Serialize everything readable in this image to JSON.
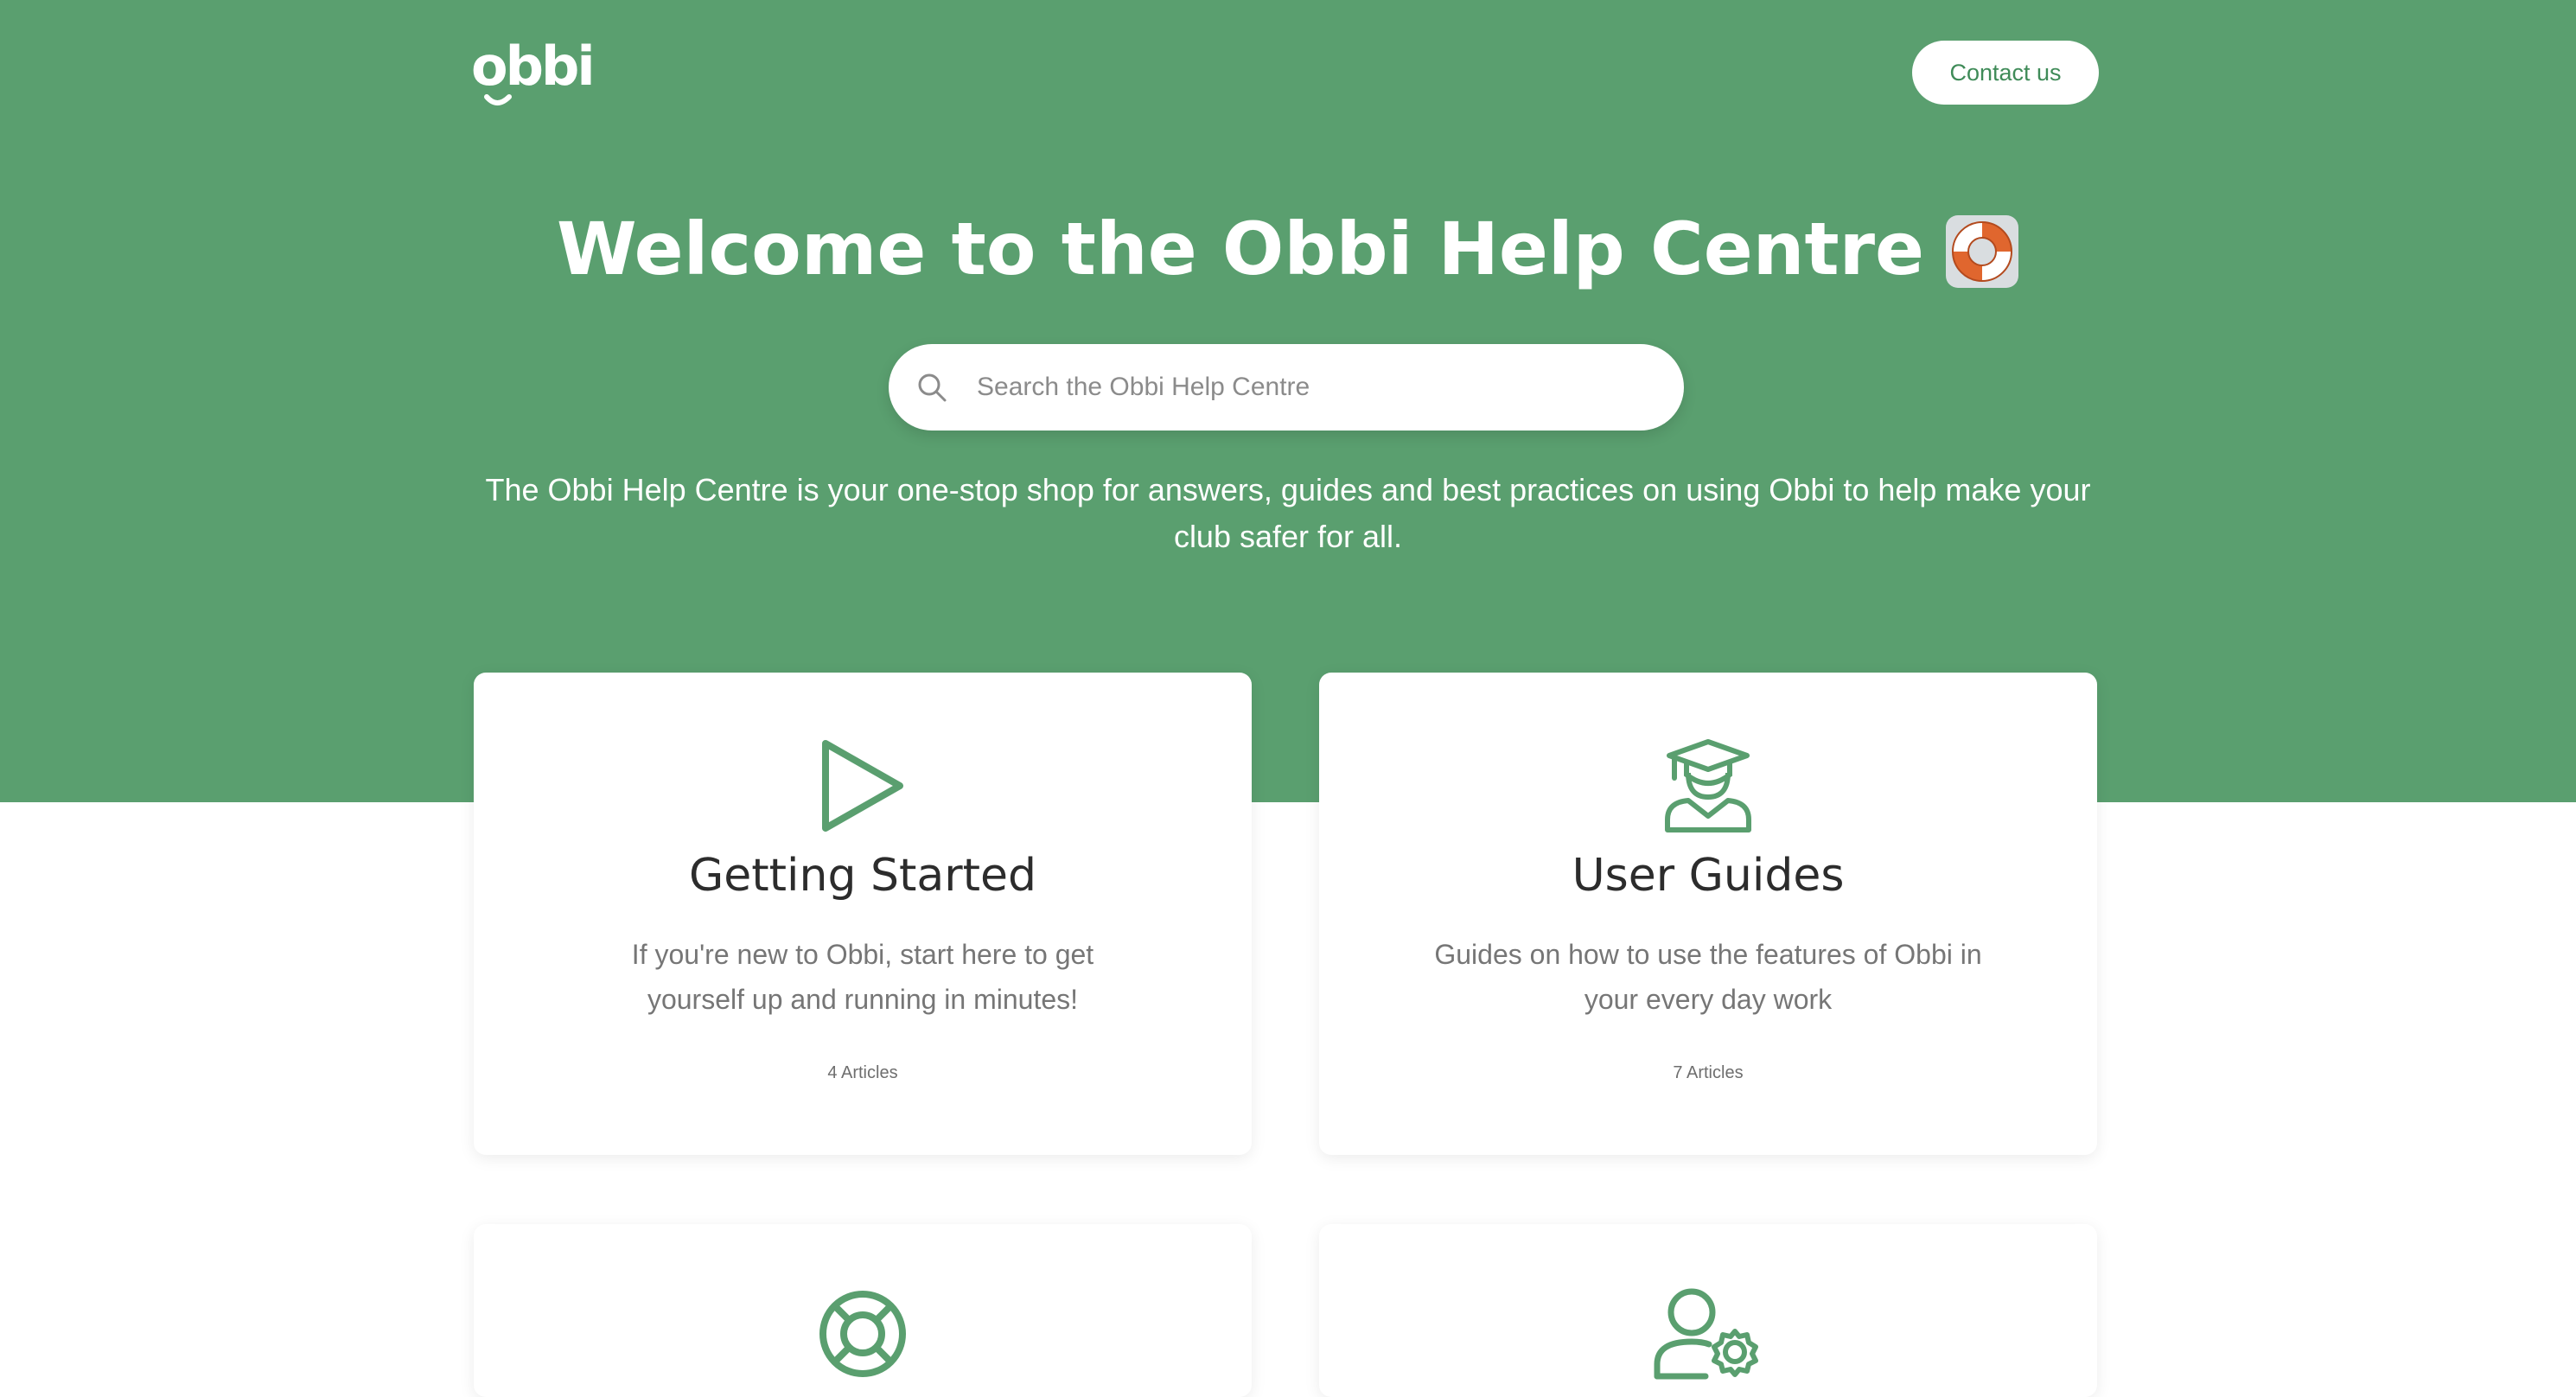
{
  "brand": {
    "logo_text": "obbi",
    "color": "#5a9f6f",
    "accent": "#3f8b58"
  },
  "header": {
    "contact_label": "Contact us"
  },
  "hero": {
    "title": "Welcome to the Obbi Help Centre",
    "title_emoji": "lifebuoy-icon",
    "description": "The Obbi Help Centre is your one-stop shop for answers, guides and best practices on using Obbi to help make your club safer for all."
  },
  "search": {
    "placeholder": "Search the Obbi Help Centre",
    "value": ""
  },
  "collections": [
    {
      "icon": "play-icon",
      "title": "Getting Started",
      "description": "If you're new to Obbi, start here to get yourself up and running in minutes!",
      "count": "4 Articles"
    },
    {
      "icon": "graduate-icon",
      "title": "User Guides",
      "description": "Guides on how to use the features of Obbi in your every day work",
      "count": "7 Articles"
    },
    {
      "icon": "lifebuoy-icon"
    },
    {
      "icon": "user-settings-icon"
    }
  ]
}
